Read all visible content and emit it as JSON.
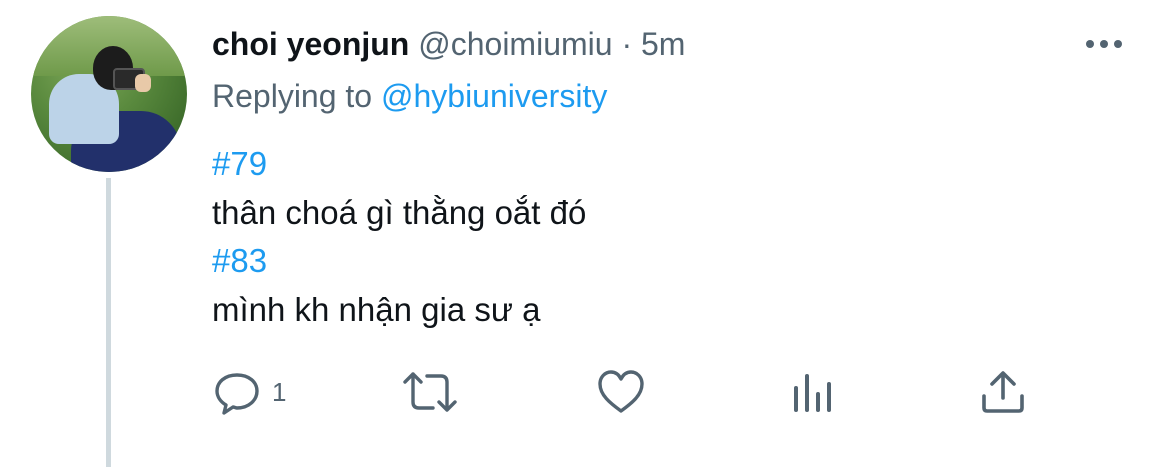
{
  "tweet": {
    "author_name": "choi yeonjun",
    "handle": "@choimiumiu",
    "separator": "·",
    "time": "5m",
    "replying_prefix": "Replying to",
    "replying_to": "@hybiuniversity",
    "lines": [
      {
        "text": "#79",
        "type": "hashtag"
      },
      {
        "text": "thân choá gì thằng oắt đó",
        "type": "text"
      },
      {
        "text": "#83",
        "type": "hashtag"
      },
      {
        "text": "mình kh nhận gia sư ạ",
        "type": "text"
      }
    ],
    "reply_count": "1"
  },
  "icons": {
    "more": "more-icon",
    "reply": "reply-icon",
    "retweet": "retweet-icon",
    "like": "heart-icon",
    "analytics": "analytics-icon",
    "share": "share-icon"
  },
  "colors": {
    "link": "#1d9bf0",
    "secondary_text": "#536471",
    "primary_text": "#0f1419",
    "thread_line": "#cfd9de"
  }
}
